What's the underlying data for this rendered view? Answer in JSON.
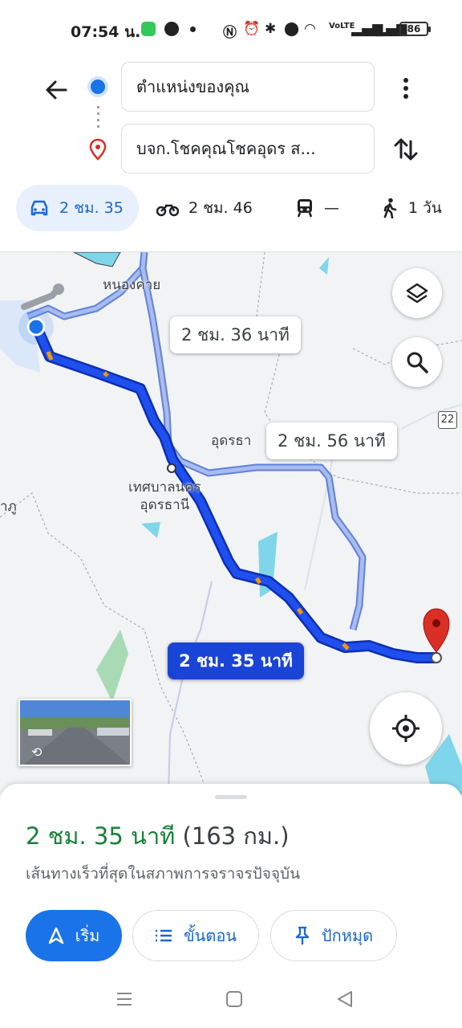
{
  "status_bar": {
    "time": "07:54 น.",
    "battery": "86",
    "network": "VoLTE"
  },
  "search": {
    "origin": "ตำแหน่งของคุณ",
    "destination": "บจก.โชคคุณโชคอุดร ส..."
  },
  "travel_modes": [
    {
      "mode": "drive",
      "label": "2 ชม. 35",
      "icon": "car-icon",
      "selected": true
    },
    {
      "mode": "motorcycle",
      "label": "2 ชม. 46",
      "icon": "motorcycle-icon"
    },
    {
      "mode": "transit",
      "label": "—",
      "icon": "train-icon"
    },
    {
      "mode": "walk",
      "label": "1 วัน",
      "icon": "walk-icon"
    }
  ],
  "map": {
    "place_labels": [
      "หนองคาย",
      "อุดรธา",
      "เทศบาลนคร\nอุดรธานี",
      "าภู"
    ],
    "route_labels": {
      "main": "2 ชม. 35 นาที",
      "alt1": "2 ชม. 36 นาที",
      "alt2": "2 ชม. 56 นาที"
    },
    "road_shield": "22",
    "colors": {
      "route_primary": "#1a44d6",
      "route_alt": "#aabbee",
      "water": "#7fd6ea",
      "park": "#a8dab5",
      "destination_pin": "#d93025"
    }
  },
  "sheet": {
    "duration": "2 ชม. 35 นาที",
    "distance": "(163 กม.)",
    "description": "เส้นทางเร็วที่สุดในสภาพการจราจรปัจจุบัน",
    "buttons": {
      "start": "เริ่ม",
      "steps": "ขั้นตอน",
      "pin": "ปักหมุด"
    }
  }
}
